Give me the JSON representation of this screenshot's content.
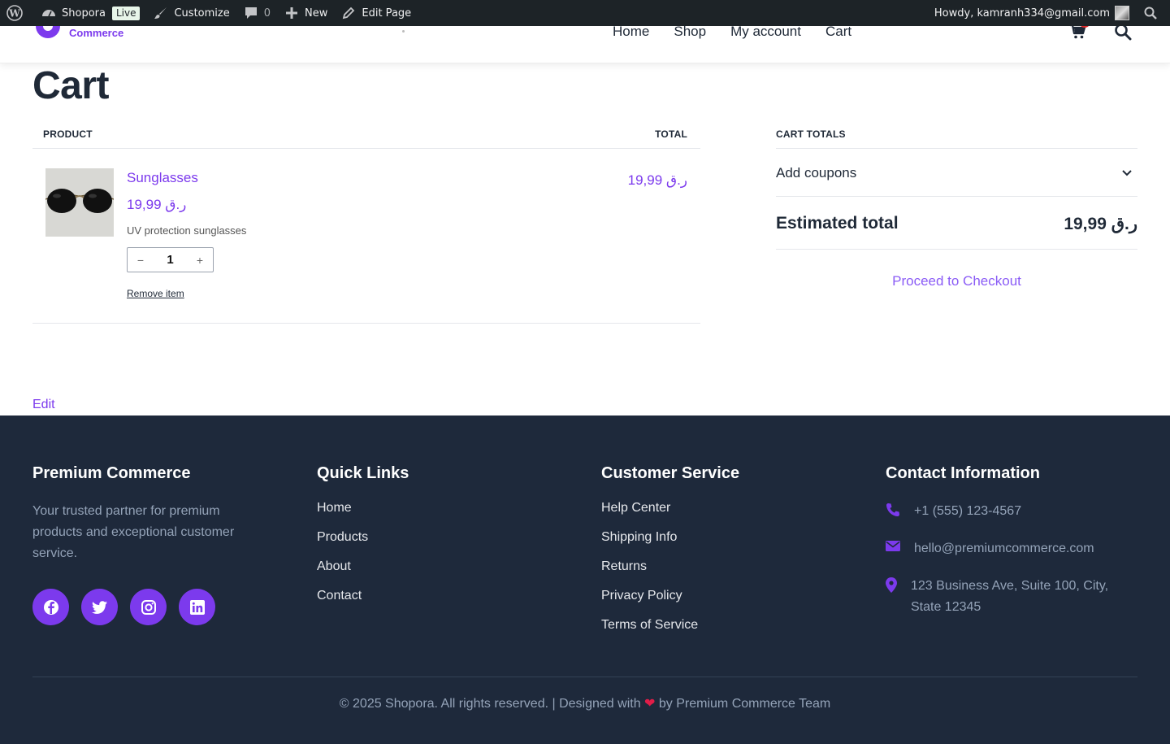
{
  "admin_bar": {
    "site_name": "Shopora",
    "live_badge": "Live",
    "customize": "Customize",
    "comments_count": "0",
    "new_label": "New",
    "edit_page": "Edit Page",
    "howdy": "Howdy, kamranh334@gmail.com"
  },
  "header": {
    "logo_sub": "Commerce",
    "nav": [
      "Home",
      "Shop",
      "My account",
      "Cart"
    ]
  },
  "page": {
    "title": "Cart",
    "edit_link": "Edit"
  },
  "cart": {
    "col_product": "PRODUCT",
    "col_total": "TOTAL",
    "items": [
      {
        "name": "Sunglasses",
        "price": "19,99 ر.ق",
        "description": "UV protection sunglasses",
        "quantity": "1",
        "qty_minus": "−",
        "qty_plus": "+",
        "remove": "Remove item",
        "line_total": "19,99 ر.ق"
      }
    ]
  },
  "totals": {
    "heading": "CART TOTALS",
    "coupons": "Add coupons",
    "estimated_label": "Estimated total",
    "estimated_value": "19,99 ر.ق",
    "checkout": "Proceed to Checkout"
  },
  "footer": {
    "brand": {
      "title": "Premium Commerce",
      "description": "Your trusted partner for premium products and exceptional customer service.",
      "socials": [
        "facebook-icon",
        "twitter-icon",
        "instagram-icon",
        "linkedin-icon"
      ]
    },
    "quick_links": {
      "title": "Quick Links",
      "items": [
        "Home",
        "Products",
        "About",
        "Contact"
      ]
    },
    "customer_service": {
      "title": "Customer Service",
      "items": [
        "Help Center",
        "Shipping Info",
        "Returns",
        "Privacy Policy",
        "Terms of Service"
      ]
    },
    "contact": {
      "title": "Contact Information",
      "phone": "+1 (555) 123-4567",
      "email": "hello@premiumcommerce.com",
      "address": "123 Business Ave, Suite 100, City, State 12345"
    },
    "copyright_pre": "© 2025 Shopora. All rights reserved. | Designed with",
    "copyright_post": "by Premium Commerce Team"
  },
  "colors": {
    "accent": "#7c3aed",
    "footer_bg": "#1e293b",
    "admin_bar_bg": "#1d2327"
  }
}
